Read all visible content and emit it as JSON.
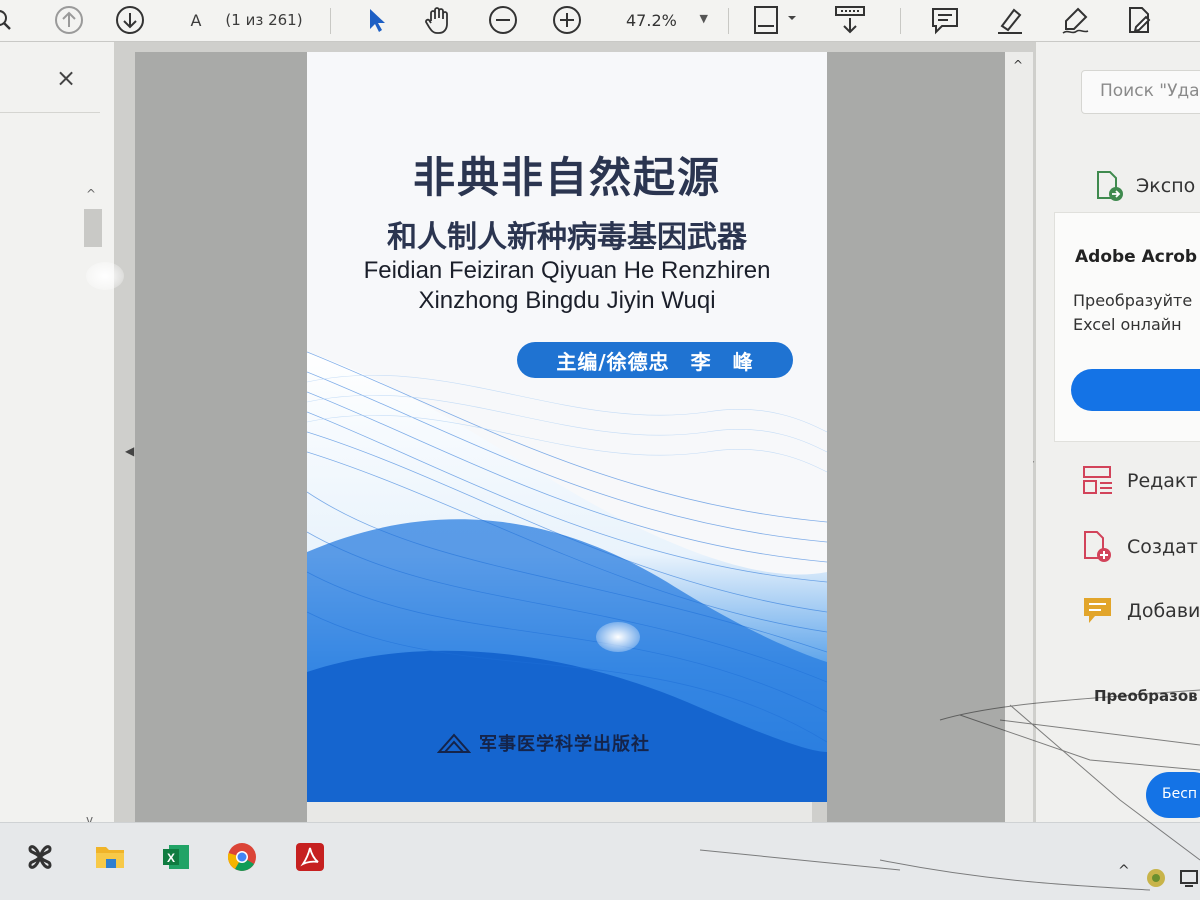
{
  "toolbar": {
    "page_field_value": "A",
    "page_count": "(1 из 261)",
    "zoom_value": "47.2%",
    "icons": [
      "search-icon",
      "page-up-icon",
      "page-down-icon",
      "select-cursor-icon",
      "hand-tool-icon",
      "zoom-out-icon",
      "zoom-in-icon",
      "fit-page-icon",
      "scroll-mode-icon",
      "comment-icon",
      "highlight-icon",
      "sign-icon",
      "edit-pdf-icon"
    ]
  },
  "left_panel": {
    "close_label": "×"
  },
  "cover": {
    "title_cn": "非典非自然起源",
    "subtitle_cn": "和人制人新种病毒基因武器",
    "title_en_line1": "Feidian Feiziran Qiyuan He Renzhiren",
    "title_en_line2": "Xinzhong Bingdu Jiyin Wuqi",
    "authors": "主编/徐德忠　李　峰",
    "publisher": "军事医学科学出版社",
    "colors": {
      "title": "#2b3550",
      "accent": "#1f73d2",
      "wave": "#1a6fd6"
    }
  },
  "right_panel": {
    "search_placeholder": "Поиск \"Уда",
    "export_label": "Экспо",
    "promo_title": "Adobe Acrob",
    "promo_text_line1": "Преобразуйте",
    "promo_text_line2": "Excel онлайн",
    "tools": [
      {
        "label": "Редакт",
        "icon": "edit-layout-icon"
      },
      {
        "label": "Создат",
        "icon": "create-pdf-icon"
      },
      {
        "label": "Добави",
        "icon": "add-comment-icon"
      }
    ],
    "convert_label": "Преобразов",
    "free_button_label": "Бесп"
  },
  "taskbar": {
    "apps": [
      "start-icon",
      "file-explorer-icon",
      "excel-icon",
      "chrome-icon",
      "acrobat-icon"
    ]
  }
}
